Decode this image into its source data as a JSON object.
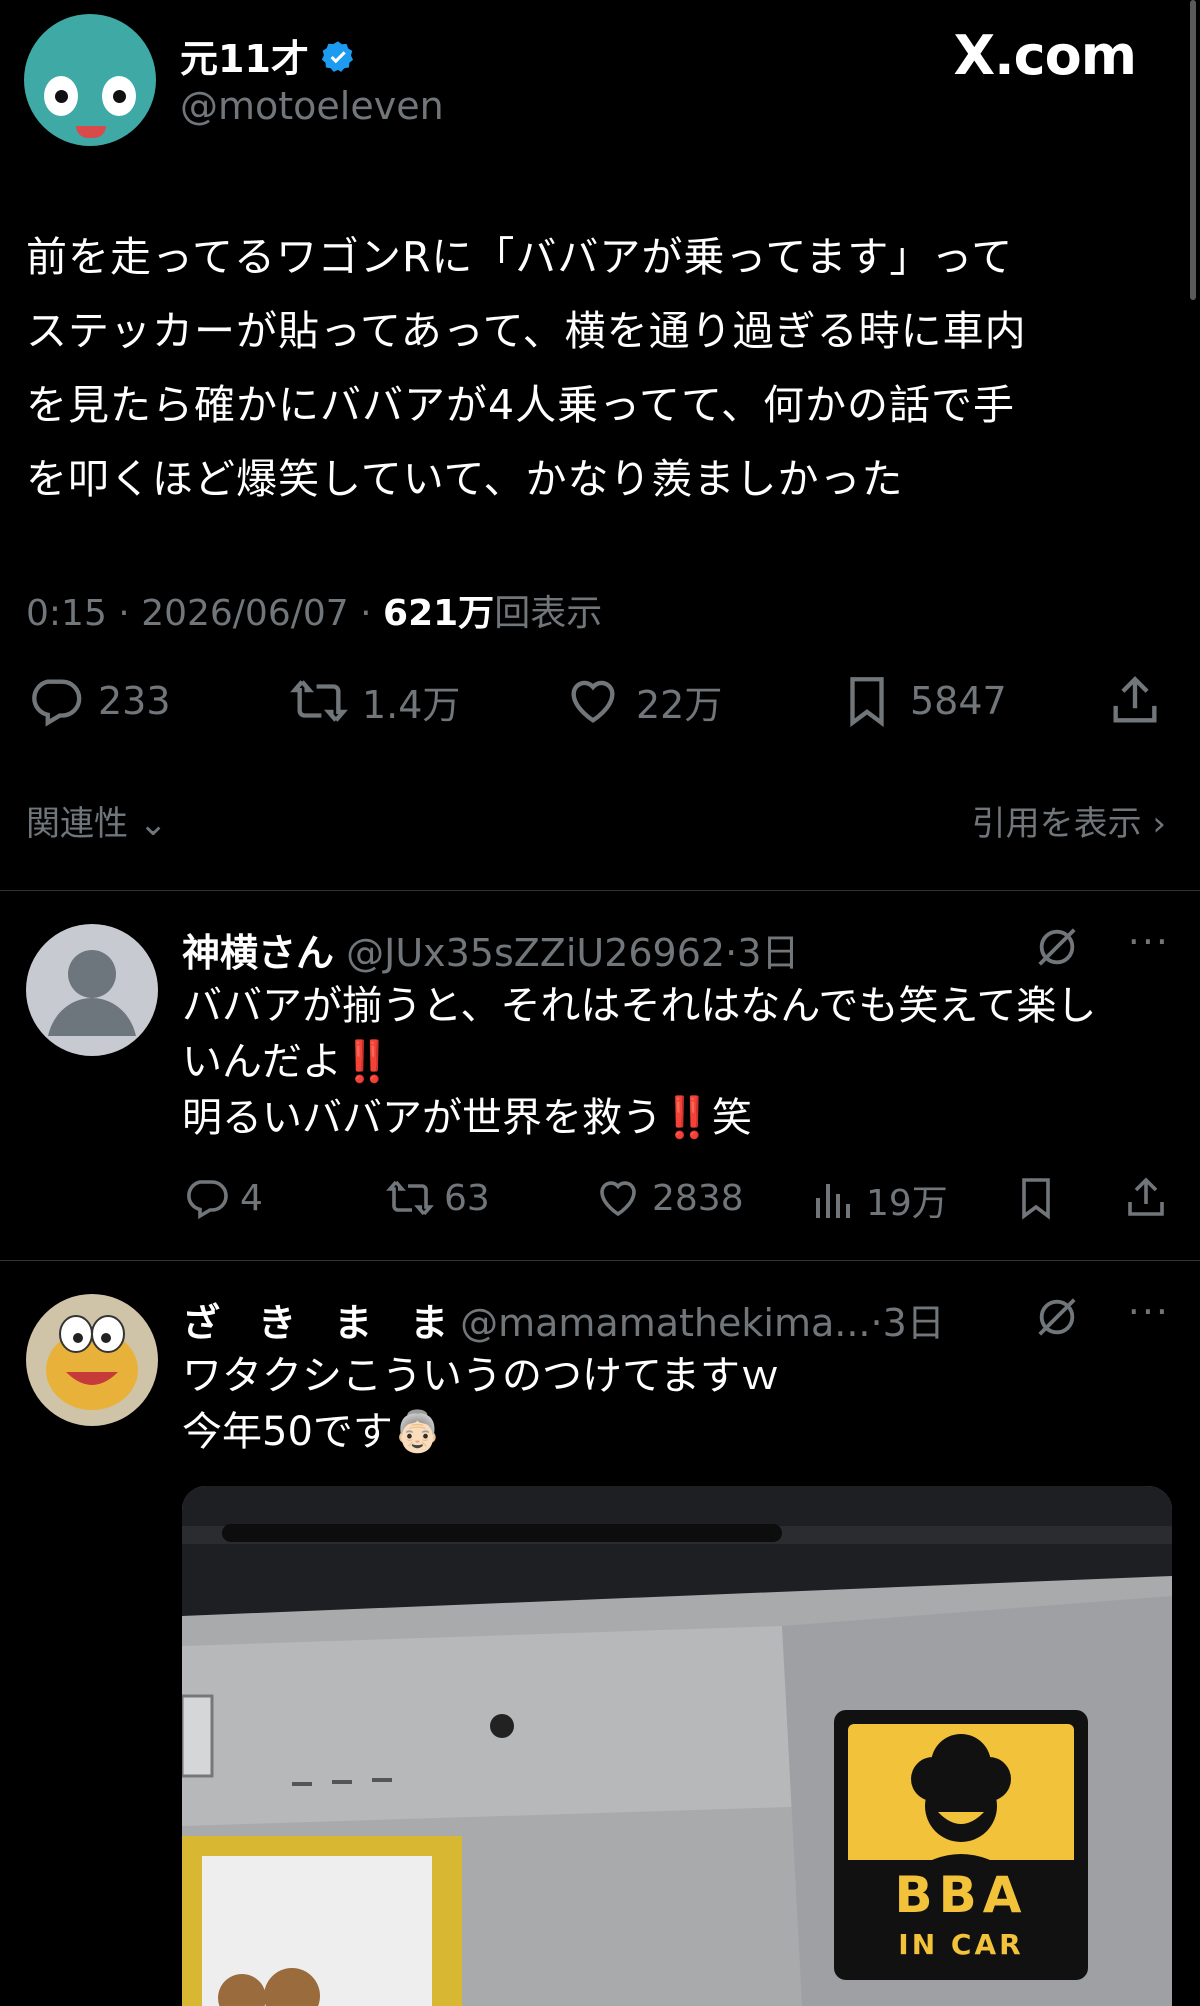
{
  "main_tweet": {
    "display_name": "元11才",
    "handle": "@motoeleven",
    "site_label": "X.com",
    "lines": [
      "前を走ってるワゴンRに「ババアが乗ってます」って",
      "ステッカーが貼ってあって、横を通り過ぎる時に車内",
      "を見たら確かにババアが4人乗ってて、何かの話で手",
      "を叩くほど爆笑していて、かなり羨ましかった"
    ],
    "time": "0:15",
    "date": "2026/06/07",
    "views_count": "621万",
    "views_label": "回表示",
    "replies": "233",
    "reposts": "1.4万",
    "likes": "22万",
    "bookmarks": "5847",
    "sort_label": "関連性",
    "quotes_label": "引用を表示"
  },
  "replies": [
    {
      "name": "神横さん",
      "handle": "@JUx35sZZiU26962",
      "time": "3日",
      "text_line1": "ババアが揃うと、それはそれはなんでも笑えて楽し",
      "text_line2": "いんだよ",
      "text_line3": "明るいババアが世界を救う",
      "text_line3_suffix": "笑",
      "bang": "‼️",
      "replies": "4",
      "reposts": "63",
      "likes": "2838",
      "views": "19万"
    },
    {
      "name": "ざ　き　ま　ま",
      "handle": "@mamamathekima...",
      "time": "3日",
      "text_line1": "ワタクシこういうのつけてますｗ",
      "text_line2": "今年50です",
      "emoji": "👵🏻",
      "sticker_line1": "BBA",
      "sticker_line2": "IN CAR"
    }
  ],
  "colors": {
    "background": "#000000",
    "text": "#e7e9ea",
    "muted": "#71767b",
    "verified": "#1d9bf0",
    "divider": "#2f3336"
  }
}
